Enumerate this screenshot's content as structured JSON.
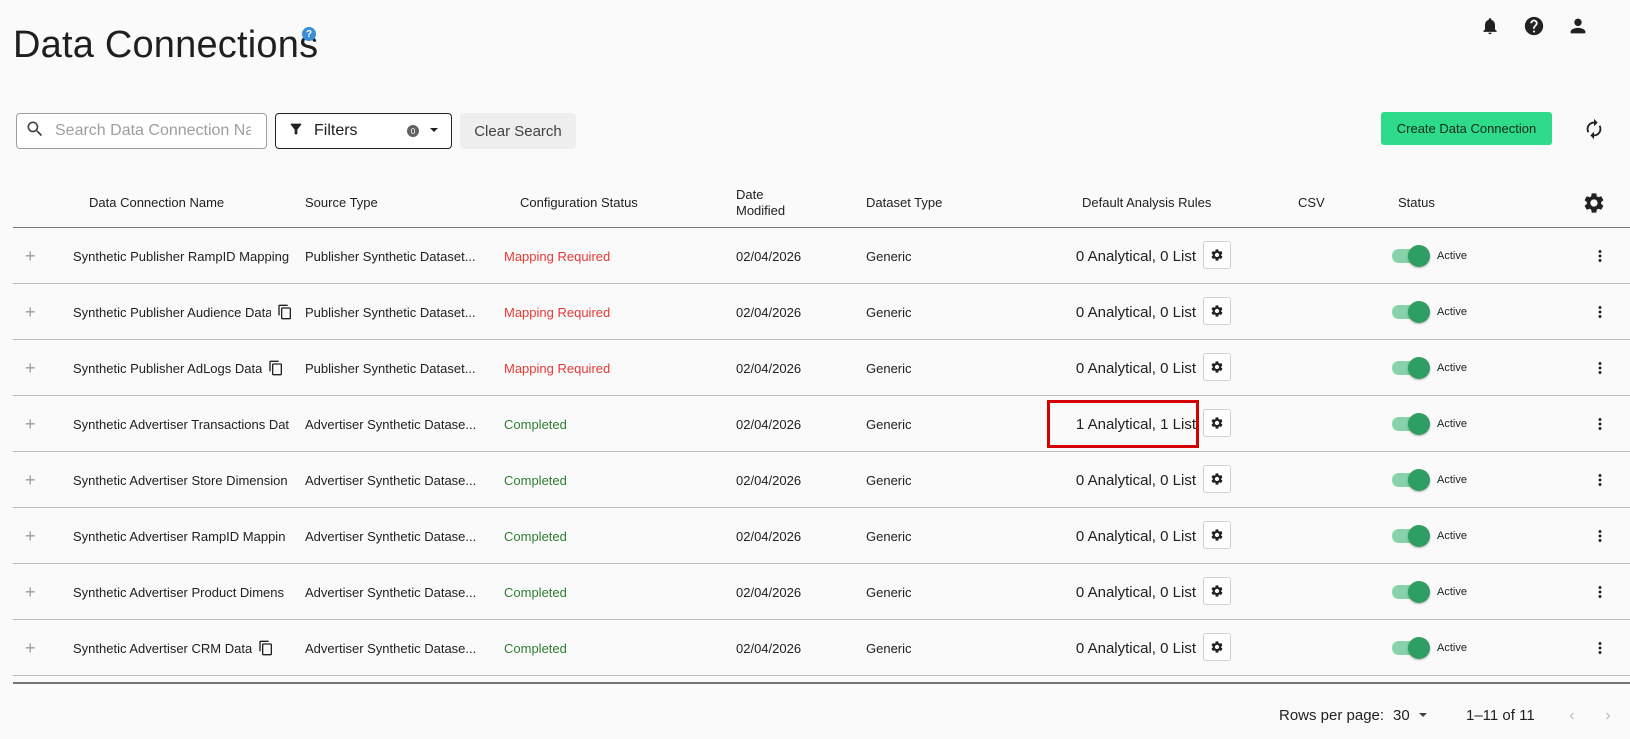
{
  "page": {
    "title": "Data Connections",
    "help_badge": "?"
  },
  "toolbar": {
    "search_placeholder": "Search Data Connection Name",
    "filters_label": "Filters",
    "filters_count": "0",
    "clear_label": "Clear Search",
    "create_label": "Create Data Connection"
  },
  "columns": {
    "name": "Data Connection Name",
    "source": "Source Type",
    "config": "Configuration Status",
    "date": "Date Modified",
    "dataset": "Dataset Type",
    "rules": "Default Analysis Rules",
    "csv": "CSV",
    "status": "Status"
  },
  "rows": [
    {
      "name": "Synthetic Publisher RampID Mapping",
      "source": "Publisher Synthetic Dataset...",
      "config": "Mapping Required",
      "config_kind": "required",
      "date": "02/04/2026",
      "dataset": "Generic",
      "rules": "0 Analytical, 0 List",
      "status": "Active",
      "copy": false
    },
    {
      "name": "Synthetic Publisher Audience Data",
      "source": "Publisher Synthetic Dataset...",
      "config": "Mapping Required",
      "config_kind": "required",
      "date": "02/04/2026",
      "dataset": "Generic",
      "rules": "0 Analytical, 0 List",
      "status": "Active",
      "copy": true
    },
    {
      "name": "Synthetic Publisher AdLogs Data",
      "source": "Publisher Synthetic Dataset...",
      "config": "Mapping Required",
      "config_kind": "required",
      "date": "02/04/2026",
      "dataset": "Generic",
      "rules": "0 Analytical, 0 List",
      "status": "Active",
      "copy": true
    },
    {
      "name": "Synthetic Advertiser Transactions Dat",
      "source": "Advertiser Synthetic Datase...",
      "config": "Completed",
      "config_kind": "completed",
      "date": "02/04/2026",
      "dataset": "Generic",
      "rules": "1 Analytical, 1 List",
      "status": "Active",
      "copy": false
    },
    {
      "name": "Synthetic Advertiser Store Dimension",
      "source": "Advertiser Synthetic Datase...",
      "config": "Completed",
      "config_kind": "completed",
      "date": "02/04/2026",
      "dataset": "Generic",
      "rules": "0 Analytical, 0 List",
      "status": "Active",
      "copy": false
    },
    {
      "name": "Synthetic Advertiser RampID Mappin",
      "source": "Advertiser Synthetic Datase...",
      "config": "Completed",
      "config_kind": "completed",
      "date": "02/04/2026",
      "dataset": "Generic",
      "rules": "0 Analytical, 0 List",
      "status": "Active",
      "copy": false
    },
    {
      "name": "Synthetic Advertiser Product Dimens",
      "source": "Advertiser Synthetic Datase...",
      "config": "Completed",
      "config_kind": "completed",
      "date": "02/04/2026",
      "dataset": "Generic",
      "rules": "0 Analytical, 0 List",
      "status": "Active",
      "copy": false
    },
    {
      "name": "Synthetic Advertiser CRM Data",
      "source": "Advertiser Synthetic Datase...",
      "config": "Completed",
      "config_kind": "completed",
      "date": "02/04/2026",
      "dataset": "Generic",
      "rules": "0 Analytical, 0 List",
      "status": "Active",
      "copy": true
    }
  ],
  "pagination": {
    "rows_per_page_label": "Rows per page:",
    "rows_per_page_value": "30",
    "range": "1–11 of 11"
  },
  "colors": {
    "accent": "#2edb8a",
    "error": "#e53935",
    "success": "#2e7d32",
    "highlight": "#d50000"
  }
}
